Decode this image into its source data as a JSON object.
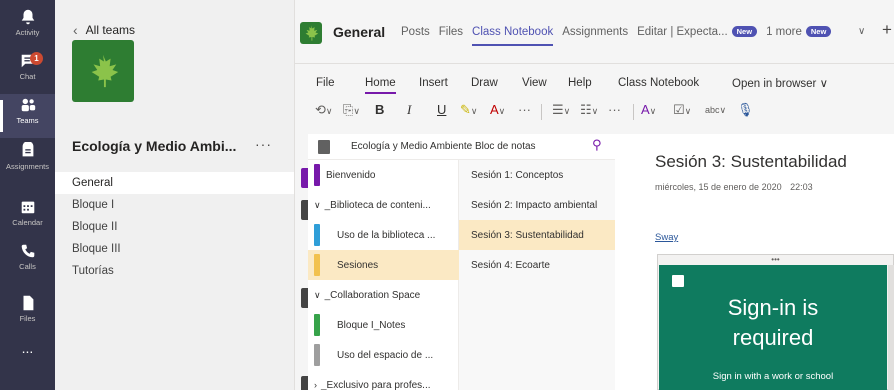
{
  "rail": {
    "items": [
      {
        "label": "Activity"
      },
      {
        "label": "Chat",
        "badge": "1"
      },
      {
        "label": "Teams"
      },
      {
        "label": "Assignments"
      },
      {
        "label": "Calendar"
      },
      {
        "label": "Calls"
      },
      {
        "label": "Files"
      },
      {
        "label": "..."
      }
    ]
  },
  "teams_panel": {
    "back_label": "All teams",
    "team_name": "Ecología y Medio Ambi...",
    "more": "···",
    "channels": [
      "General",
      "Bloque I",
      "Bloque II",
      "Bloque III",
      "Tutorías"
    ]
  },
  "header": {
    "channel_title": "General",
    "tabs": [
      "Posts",
      "Files",
      "Class Notebook",
      "Assignments",
      "Editar | Expecta..."
    ],
    "new_badge": "New",
    "more_tabs": "1 more",
    "add": "+"
  },
  "ribbon": {
    "menus": [
      "File",
      "Home",
      "Insert",
      "Draw",
      "View",
      "Help",
      "Class Notebook",
      "Open in browser ∨"
    ],
    "bold": "B",
    "italic": "I",
    "underline": "U",
    "spell": "abc"
  },
  "notebook": {
    "title": "Ecología y Medio Ambiente Bloc de notas",
    "sections": [
      "Bienvenido",
      "_Biblioteca de conteni...",
      "Uso de la biblioteca ...",
      "Sesiones",
      "_Collaboration Space",
      "Bloque I_Notes",
      "Uso del espacio de ...",
      "_Exclusivo para profes..."
    ],
    "pages": [
      "Sesión 1: Conceptos",
      "Sesión 2: Impacto ambiental",
      "Sesión 3: Sustentabilidad",
      "Sesión 4: Ecoarte"
    ]
  },
  "page": {
    "title": "Sesión 3: Sustentabilidad",
    "date": "miércoles, 15 de enero de 2020",
    "time": "22:03",
    "link": "Sway",
    "embed_dots": "•••",
    "signin_line1": "Sign-in is",
    "signin_line2": "required",
    "signin_sub": "Sign in with a work or school"
  },
  "colors": {
    "rail": "#33344a",
    "accent": "#4f52b2",
    "onenote": "#7719aa",
    "sway": "#0f7b5f",
    "team": "#2e7d32"
  }
}
